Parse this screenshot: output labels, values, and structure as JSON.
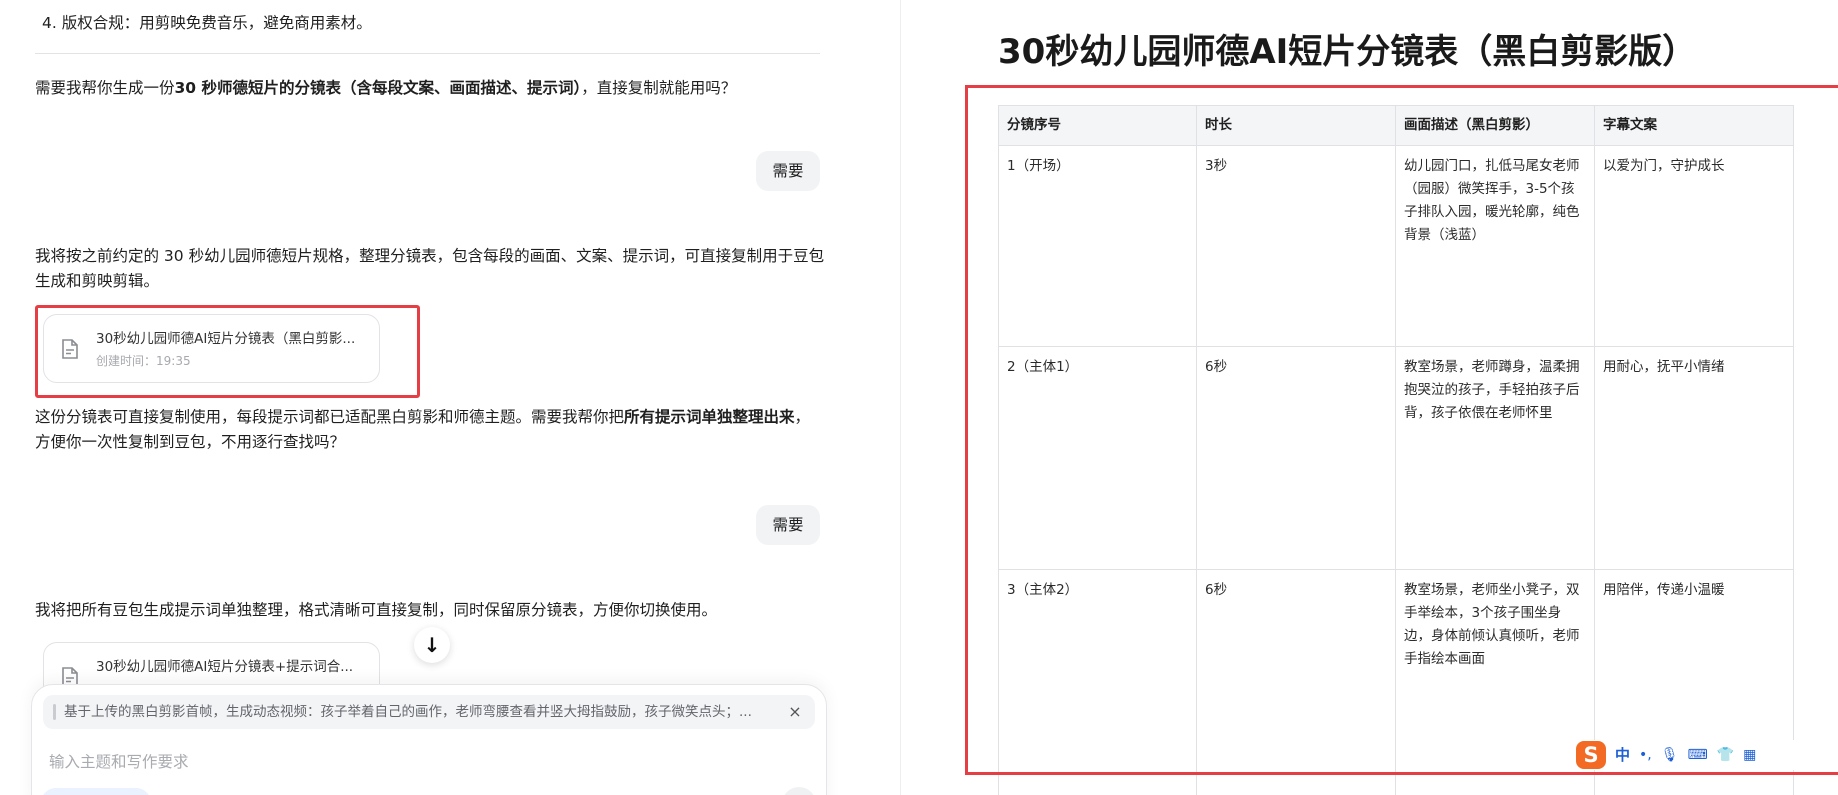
{
  "chat": {
    "prev_tail": "4. 版权合规：用剪映免费音乐，避免商用素材。",
    "q1_pre": "需要我帮你生成一份",
    "q1_bold": "30 秒师德短片的分镜表（含每段文案、画面描述、提示词）",
    "q1_post": "，直接复制就能用吗？",
    "user_reply_1": "需要",
    "answer1": "我将按之前约定的 30 秒幼儿园师德短片规格，整理分镜表，包含每段的画面、文案、提示词，可直接复制用于豆包生成和剪映剪辑。",
    "file1": {
      "title": "30秒幼儿园师德AI短片分镜表（黑白剪影...",
      "time": "创建时间：19:35"
    },
    "q2_pre": "这份分镜表可直接复制使用，每段提示词都已适配黑白剪影和师德主题。需要我帮你把",
    "q2_bold": "所有提示词单独整理出来",
    "q2_post": "，方便你一次性复制到豆包，不用逐行查找吗？",
    "user_reply_2": "需要",
    "answer2": "我将把所有豆包生成提示词单独整理，格式清晰可直接复制，同时保留原分镜表，方便你切换使用。",
    "file2": {
      "title": "30秒幼儿园师德AI短片分镜表+提示词合..."
    },
    "scroll_down_icon": "↓"
  },
  "composer": {
    "quote": "基于上传的黑白剪影首帧，生成动态视频：孩子举着自己的画作，老师弯腰查看并竖大拇指鼓励，孩子微笑点头；...",
    "close_icon": "×",
    "placeholder": "输入主题和写作要求"
  },
  "doc": {
    "title": "30秒幼儿园师德AI短片分镜表（黑白剪影版）",
    "headers": [
      "分镜序号",
      "时长",
      "画面描述（黑白剪影）",
      "字幕文案"
    ],
    "rows": [
      [
        "1（开场）",
        "3秒",
        "幼儿园门口，扎低马尾女老师（园服）微笑挥手，3-5个孩子排队入园，暖光轮廓，纯色背景（浅蓝）",
        "以爱为门，守护成长"
      ],
      [
        "2（主体1）",
        "6秒",
        "教室场景，老师蹲身，温柔拥抱哭泣的孩子，手轻拍孩子后背，孩子依偎在老师怀里",
        "用耐心，抚平小情绪"
      ],
      [
        "3（主体2）",
        "6秒",
        "教室场景，老师坐小凳子，双手举绘本，3个孩子围坐身边，身体前倾认真倾听，老师手指绘本画面",
        "用陪伴，传递小温暖"
      ]
    ]
  },
  "ime": {
    "logo": "S",
    "lang": "中",
    "punct": "•,",
    "mic": "🎙",
    "keyboard": "⌨",
    "skin": "👕",
    "grid": "▦"
  },
  "colors": {
    "highlight": "#e53e44",
    "ime_blue": "#1e5fd6",
    "ime_orange": "#f26a24"
  }
}
